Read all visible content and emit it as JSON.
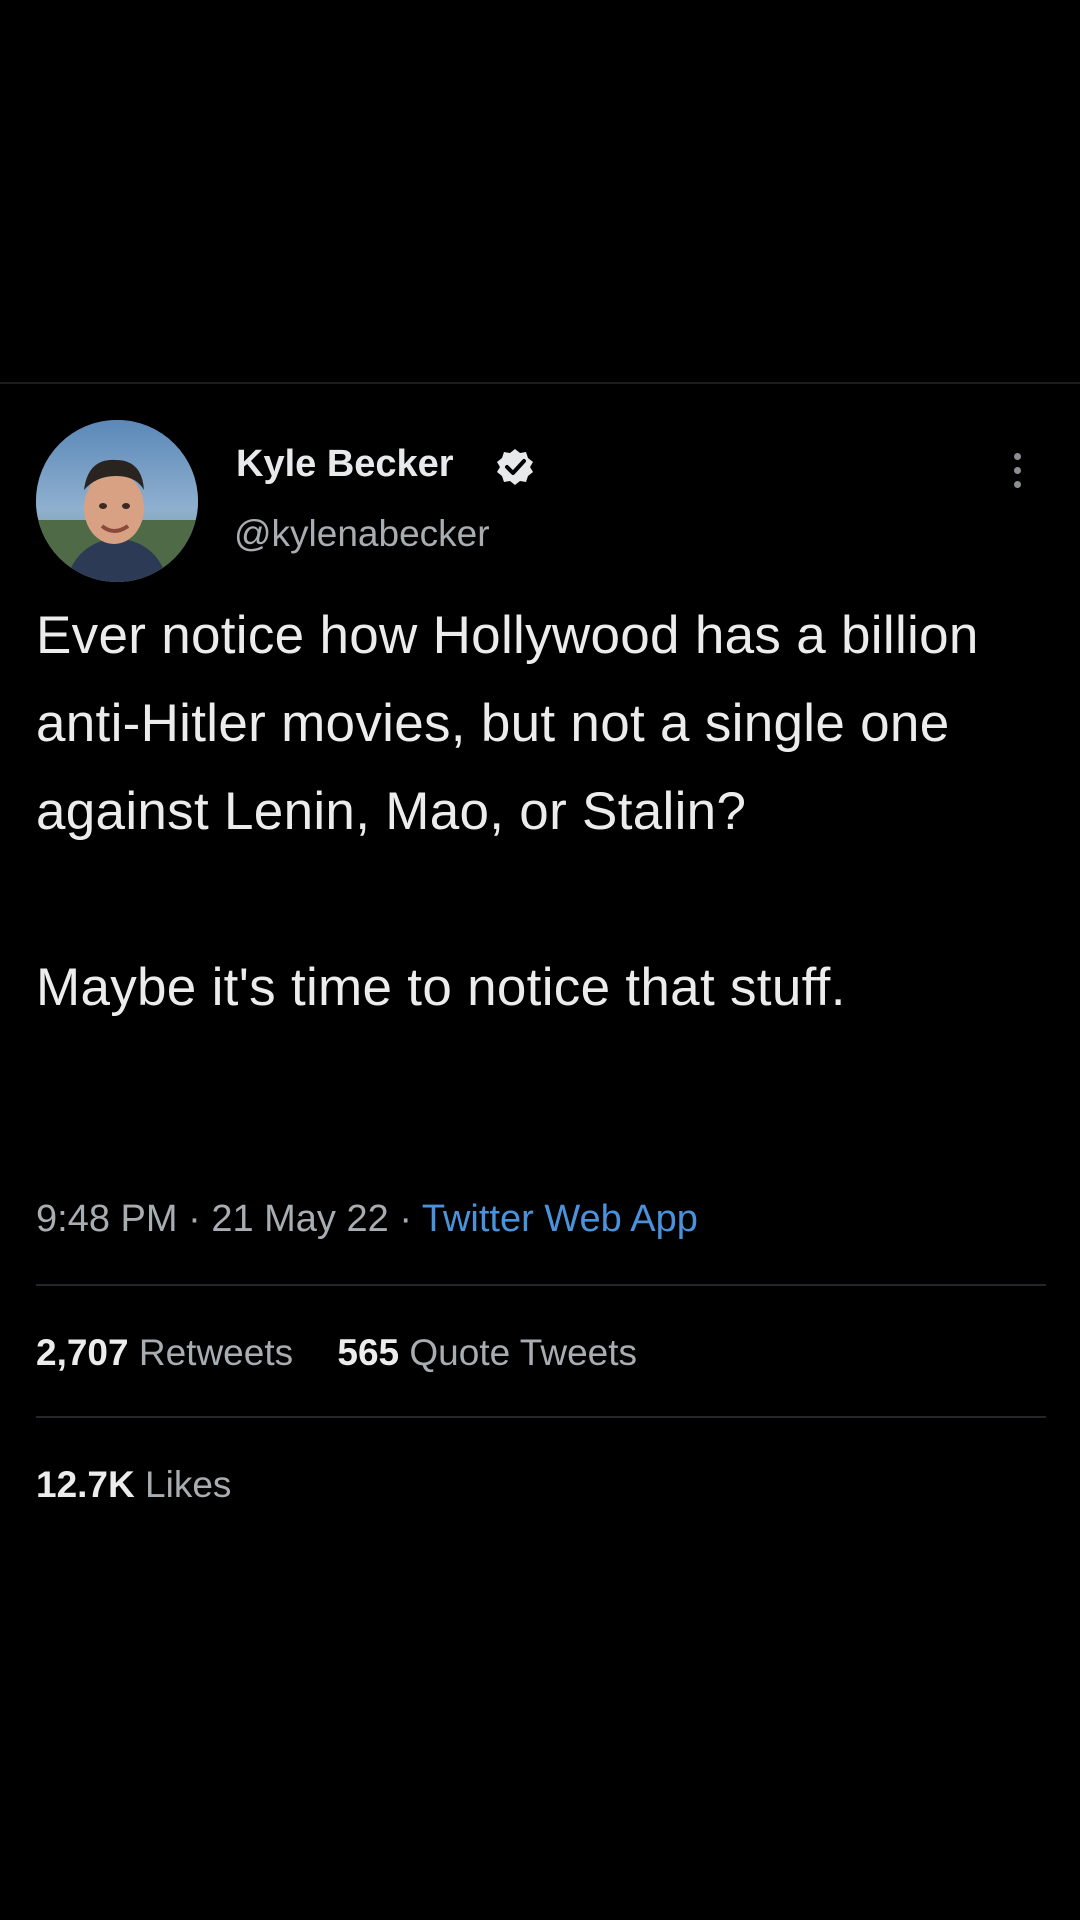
{
  "author": {
    "display_name": "Kyle Becker",
    "handle": "@kylenabecker",
    "verified_badge_icon": "verified-check-icon",
    "avatar_icon": "avatar-photo"
  },
  "more_icon": "more-vertical-icon",
  "tweet": {
    "paragraphs": [
      "Ever notice how Hollywood has a billion anti-Hitler movies, but not a single one against Lenin, Mao, or Stalin?",
      "Maybe it's time to notice that stuff."
    ],
    "time": "9:48 PM",
    "separator": "·",
    "date": "21 May 22",
    "source": "Twitter Web App"
  },
  "stats": {
    "retweets_count": "2,707",
    "retweets_label": "Retweets",
    "quotes_count": "565",
    "quotes_label": "Quote Tweets",
    "likes_count": "12.7K",
    "likes_label": "Likes"
  },
  "colors": {
    "background": "#000000",
    "primary_text": "#e7e9ea",
    "secondary_text": "#a8adb2",
    "link": "#4a93dc",
    "divider": "#24272a"
  }
}
